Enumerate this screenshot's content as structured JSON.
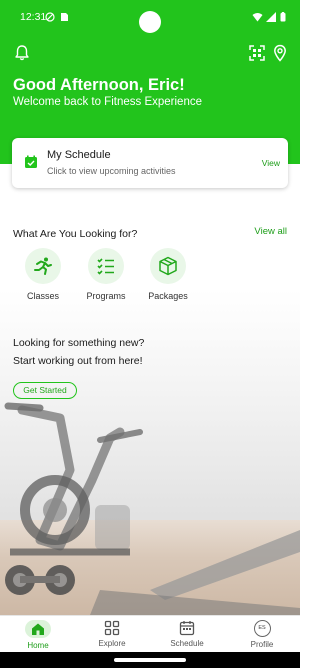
{
  "status_bar": {
    "time": "12:31"
  },
  "header": {
    "greeting": "Good Afternoon, Eric!",
    "subtitle": "Welcome back to Fitness Experience",
    "icons": [
      "bell-icon",
      "qr-scan-icon",
      "location-pin-icon"
    ],
    "accent_color": "#22c41c"
  },
  "schedule_card": {
    "title": "My Schedule",
    "subtitle": "Click to view upcoming activities",
    "action": "View",
    "icon": "calendar-check-icon"
  },
  "categories": {
    "title": "What Are You Looking for?",
    "view_all": "View all",
    "items": [
      {
        "label": "Classes",
        "icon": "running-person-icon"
      },
      {
        "label": "Programs",
        "icon": "checklist-icon"
      },
      {
        "label": "Packages",
        "icon": "package-box-icon"
      }
    ]
  },
  "promo": {
    "line1": "Looking for something new?",
    "line2": "Start working out from here!",
    "button": "Get Started"
  },
  "bottom_nav": {
    "items": [
      {
        "label": "Home",
        "icon": "home-icon",
        "active": true
      },
      {
        "label": "Explore",
        "icon": "grid-icon",
        "active": false
      },
      {
        "label": "Schedule",
        "icon": "calendar-icon",
        "active": false
      },
      {
        "label": "Profile",
        "icon": "avatar",
        "active": false,
        "initials": "ES"
      }
    ]
  }
}
